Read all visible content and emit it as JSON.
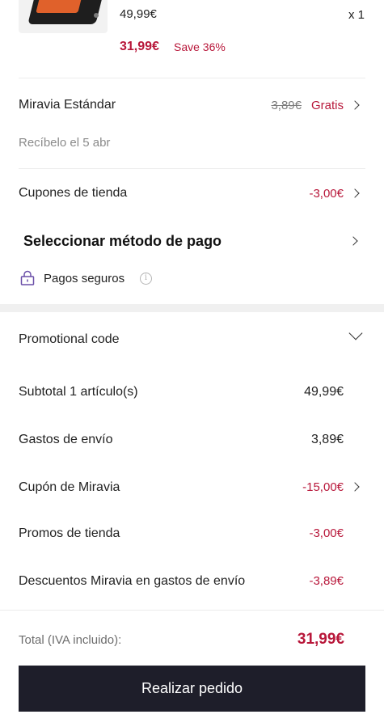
{
  "product": {
    "image_icon": "griddle-product-image",
    "original_price": "49,99€",
    "quantity": "x 1",
    "sale_price": "31,99€",
    "save_text": "Save 36%"
  },
  "shipping": {
    "method": "Miravia Estándar",
    "old_price": "3,89€",
    "price": "Gratis",
    "delivery": "Recíbelo el 5 abr"
  },
  "store_coupons": {
    "label": "Cupones de tienda",
    "value": "-3,00€"
  },
  "payment": {
    "label": "Seleccionar método de pago",
    "secure_label": "Pagos seguros",
    "info_glyph": "i"
  },
  "promo": {
    "label": "Promotional code"
  },
  "summary": {
    "subtotal_label": "Subtotal 1 artículo(s)",
    "subtotal_value": "49,99€",
    "shipping_label": "Gastos de envío",
    "shipping_value": "3,89€",
    "miravia_coupon_label": "Cupón de Miravia",
    "miravia_coupon_value": "-15,00€",
    "store_promos_label": "Promos de tienda",
    "store_promos_value": "-3,00€",
    "shipping_discount_label": "Descuentos Miravia en gastos de envío",
    "shipping_discount_value": "-3,89€"
  },
  "footer": {
    "total_label": "Total (IVA incluido):",
    "total_value": "31,99€",
    "button_label": "Realizar pedido"
  },
  "colors": {
    "accent": "#b8173a",
    "button_bg": "#1e1e2a",
    "lock_icon": "#6a4fa8"
  }
}
